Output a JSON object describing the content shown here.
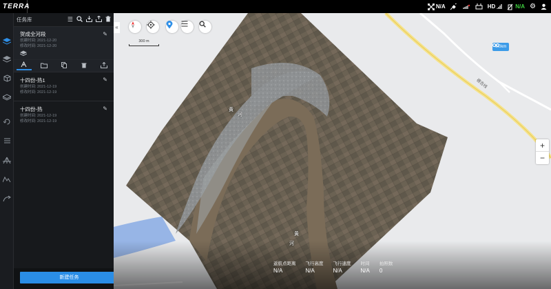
{
  "app": {
    "logo": "TERRA"
  },
  "status_bar": {
    "items": [
      {
        "icon": "drone-icon",
        "label": "N/A"
      },
      {
        "icon": "satellite-icon",
        "label": ""
      },
      {
        "icon": "signal-off-icon",
        "label": ""
      },
      {
        "icon": "remote-controller-icon",
        "label": ""
      },
      {
        "icon": "hd-signal-icon",
        "label": "HD"
      },
      {
        "icon": "battery-icon",
        "label": "N/A"
      }
    ],
    "accent_color": "#3ecb3e"
  },
  "rail": {
    "items": [
      {
        "icon": "mission-icon",
        "active": true
      },
      {
        "icon": "layers-icon"
      },
      {
        "icon": "box-icon"
      },
      {
        "icon": "model-icon"
      },
      {
        "icon": "rotate-icon"
      },
      {
        "icon": "list-icon"
      },
      {
        "icon": "tripod-icon"
      },
      {
        "icon": "terrain-icon"
      },
      {
        "icon": "curve-icon"
      }
    ]
  },
  "panel": {
    "title": "任务库",
    "tasks": [
      {
        "name": "贺成全河段",
        "created": "创建时间: 2021-12-20",
        "modified": "修改时间: 2021-12-20"
      },
      {
        "name": "十四份-热1",
        "created": "创建时间: 2021-12-19",
        "modified": "修改时间: 2021-12-19"
      },
      {
        "name": "十四份-热",
        "created": "创建时间: 2021-12-19",
        "modified": "修改时间: 2021-12-19"
      }
    ],
    "new_task_label": "新建任务"
  },
  "map": {
    "scale_label": "300 m",
    "road_label": "德吉线",
    "badge_label": "0.0km",
    "river_label_1": "黄",
    "river_label_2": "河",
    "river_label_3": "黄",
    "river_label_4": "河",
    "zoom_in": "+",
    "zoom_out": "−",
    "collapse_label": "«"
  },
  "stats": [
    {
      "label": "返航点距离",
      "value": "N/A"
    },
    {
      "label": "飞行高度",
      "value": "N/A"
    },
    {
      "label": "飞行速度",
      "value": "N/A"
    },
    {
      "label": "时间",
      "value": "N/A"
    },
    {
      "label": "拍照数",
      "value": "0"
    }
  ]
}
